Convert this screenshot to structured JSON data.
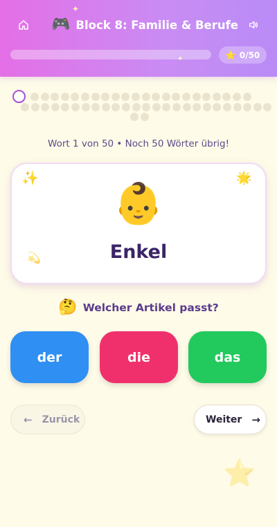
{
  "header": {
    "title_emoji": "🎮",
    "title": "Block 8: Familie & Berufe",
    "home_icon": "home-icon",
    "sound_icon": "speaker-icon",
    "progress": 0.0,
    "score_icon": "⭐",
    "score": "0/50"
  },
  "progress_dots": {
    "total": 50,
    "current_index": 0
  },
  "counter": {
    "text": "Wort 1 von 50  • Noch 50 Wörter übrig!"
  },
  "card": {
    "emoji": "👶",
    "word": "Enkel",
    "deco_top_left": "✨",
    "deco_top_right": "🌟",
    "deco_bottom_left": "💫"
  },
  "question": {
    "emoji": "🤔",
    "text": "Welcher Artikel passt?"
  },
  "articles": {
    "der": "der",
    "die": "die",
    "das": "das"
  },
  "nav": {
    "back_label": "Zurück",
    "back_arrow": "←",
    "next_label": "Weiter",
    "next_arrow": "→"
  },
  "colors": {
    "header_gradient_start": "#e46fe6",
    "header_gradient_end": "#b98bf6",
    "der": "#2f8ff2",
    "die": "#f0306c",
    "das": "#22c95d",
    "background": "#fefbe8"
  }
}
